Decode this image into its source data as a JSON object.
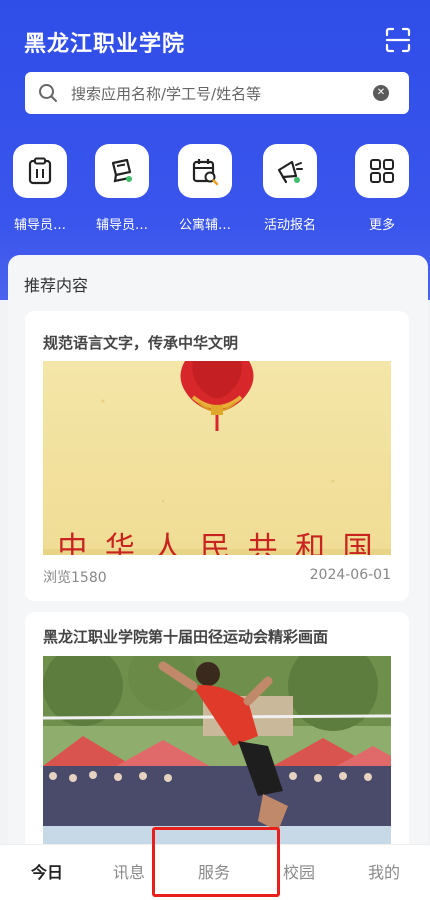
{
  "header": {
    "title": "黑龙江职业学院",
    "scan_icon": "scan-icon",
    "search": {
      "placeholder": "搜索应用名称/学工号/姓名等",
      "icon": "search-icon",
      "clear_icon": "clear-icon"
    }
  },
  "quick_actions": [
    {
      "label": "辅导员…",
      "icon": "clipboard-icon"
    },
    {
      "label": "辅导员…",
      "icon": "edit-note-icon"
    },
    {
      "label": "公寓辅…",
      "icon": "calendar-search-icon"
    },
    {
      "label": "活动报名",
      "icon": "megaphone-icon"
    },
    {
      "label": "更多",
      "icon": "grid-icon"
    }
  ],
  "recommend": {
    "section_title": "推荐内容",
    "articles": [
      {
        "title": "规范语言文字，传承中华文明",
        "image_caption": "中 华 人 民 共 和 国",
        "views": "浏览1580",
        "date": "2024-06-01"
      },
      {
        "title": "黑龙江职业学院第十届田径运动会精彩画面",
        "image_caption": ""
      }
    ]
  },
  "bottom_nav": {
    "items": [
      {
        "label": "今日",
        "active": true
      },
      {
        "label": "讯息",
        "active": false
      },
      {
        "label": "服务",
        "active": false
      },
      {
        "label": "校园",
        "active": false
      },
      {
        "label": "我的",
        "active": false
      }
    ],
    "highlighted": "服务"
  },
  "colors": {
    "header_blue": "#3553ea",
    "active_nav": "#222222",
    "highlight_red": "#e8201b"
  }
}
